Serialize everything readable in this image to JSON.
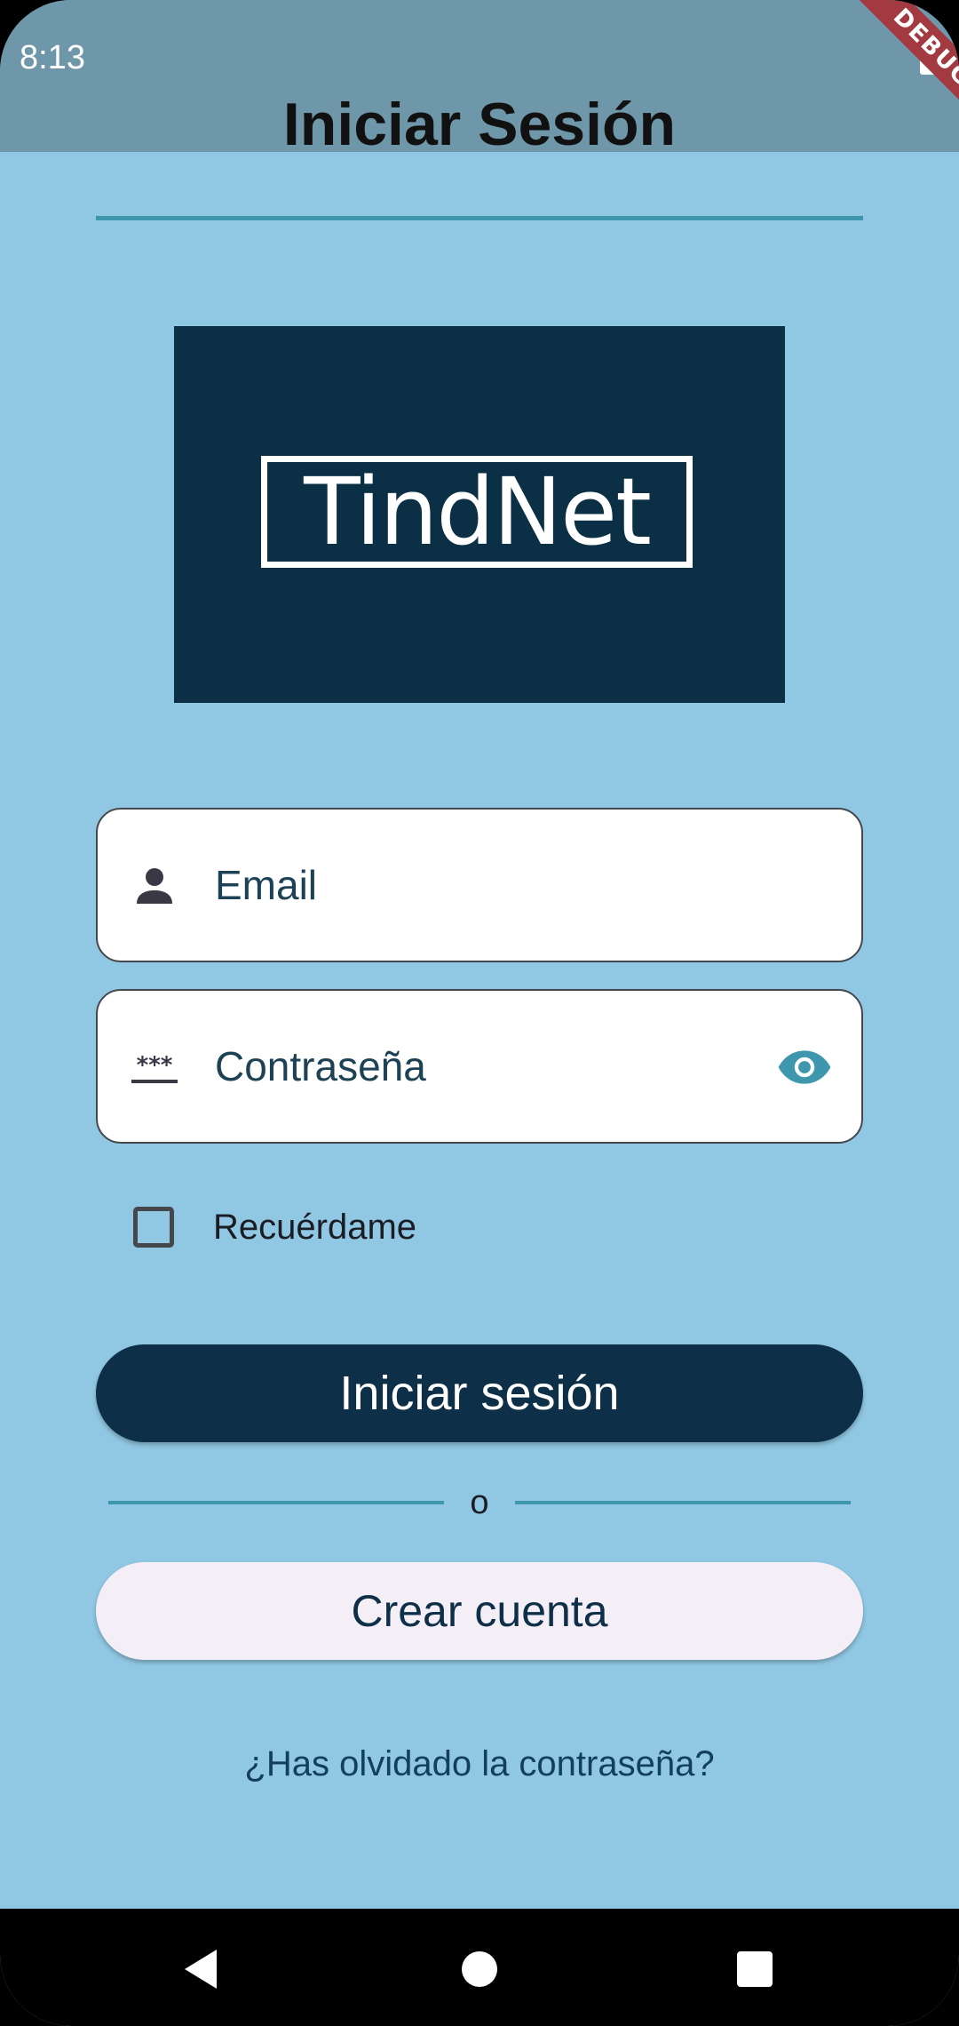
{
  "status_bar": {
    "time": "8:13",
    "battery_icon": "battery-full-icon"
  },
  "app_bar": {
    "title": "Iniciar Sesión",
    "background": "#6e97aa",
    "debug_banner": "DEBUG"
  },
  "logo": {
    "text": "TindNet",
    "background": "#0b2f45"
  },
  "form": {
    "email": {
      "placeholder": "Email",
      "icon": "person-icon",
      "value": ""
    },
    "password": {
      "placeholder": "Contraseña",
      "icon": "password-icon",
      "toggle_icon": "eye-icon",
      "value": ""
    },
    "remember_me": {
      "label": "Recuérdame",
      "checked": false
    }
  },
  "actions": {
    "login_label": "Iniciar sesión",
    "separator_text": "o",
    "create_account_label": "Crear cuenta",
    "forgot_password_label": "¿Has olvidado la contraseña?"
  },
  "nav_bar": {
    "back_icon": "back-triangle-icon",
    "home_icon": "home-circle-icon",
    "recent_icon": "recent-square-icon"
  },
  "colors": {
    "page_background": "#90c7e2",
    "accent": "#3e97ad",
    "primary_button": "#0d2f47",
    "secondary_button": "#f4eff7",
    "debug_ribbon": "#a33a42"
  }
}
